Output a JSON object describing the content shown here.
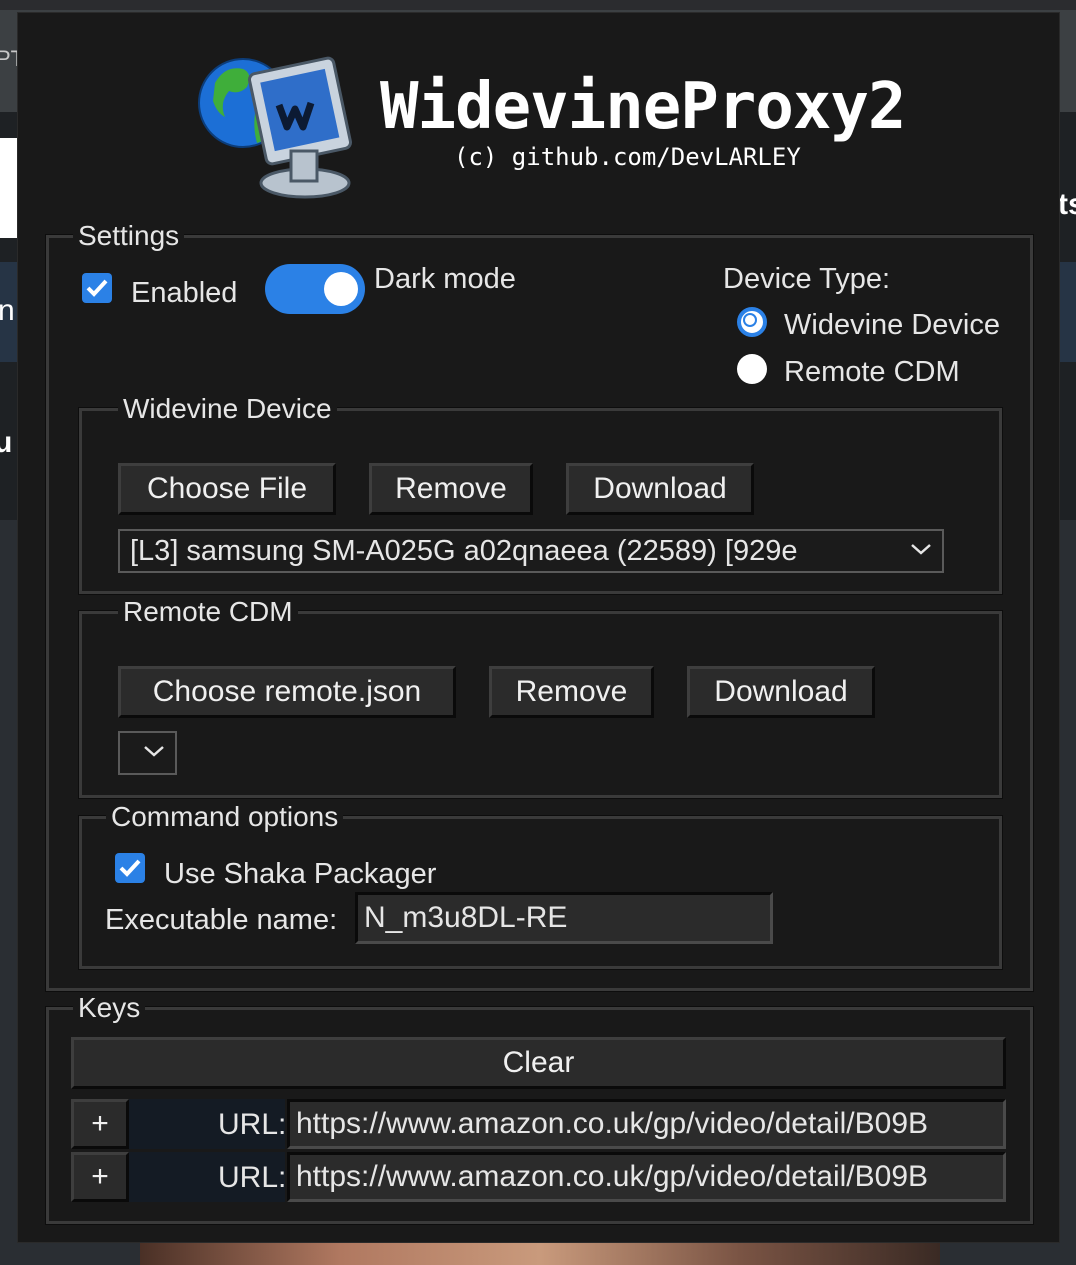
{
  "background": {
    "fragment_left_1": "PT",
    "fragment_right": "ts",
    "fragment_left_2": "n",
    "fragment_left_3": "u"
  },
  "header": {
    "title": "WidevineProxy2",
    "subtitle": "(c) github.com/DevLARLEY",
    "logo_icon": "globe-monitor-logo-icon"
  },
  "settings": {
    "legend": "Settings",
    "enabled_label": "Enabled",
    "enabled_checked": true,
    "dark_mode_label": "Dark mode",
    "dark_mode_on": true,
    "device_type": {
      "label": "Device Type:",
      "options": [
        "Widevine Device",
        "Remote CDM"
      ],
      "selected": "Widevine Device"
    },
    "widevine_device": {
      "legend": "Widevine Device",
      "choose_label": "Choose File",
      "remove_label": "Remove",
      "download_label": "Download",
      "selected_device": "[L3] samsung SM-A025G a02qnaeea (22589) [929e"
    },
    "remote_cdm": {
      "legend": "Remote CDM",
      "choose_label": "Choose remote.json",
      "remove_label": "Remove",
      "download_label": "Download",
      "selected": ""
    },
    "command_options": {
      "legend": "Command options",
      "shaka_label": "Use Shaka Packager",
      "shaka_checked": true,
      "exe_label": "Executable name:",
      "exe_value": "N_m3u8DL-RE"
    }
  },
  "keys": {
    "legend": "Keys",
    "clear_label": "Clear",
    "rows": [
      {
        "expand": "+",
        "url_label": "URL:",
        "url": "https://www.amazon.co.uk/gp/video/detail/B09B"
      },
      {
        "expand": "+",
        "url_label": "URL:",
        "url": "https://www.amazon.co.uk/gp/video/detail/B09B"
      }
    ]
  },
  "colors": {
    "accent": "#2b81e6",
    "panel_bg": "#191919",
    "button_bg": "#2b2b2b"
  }
}
